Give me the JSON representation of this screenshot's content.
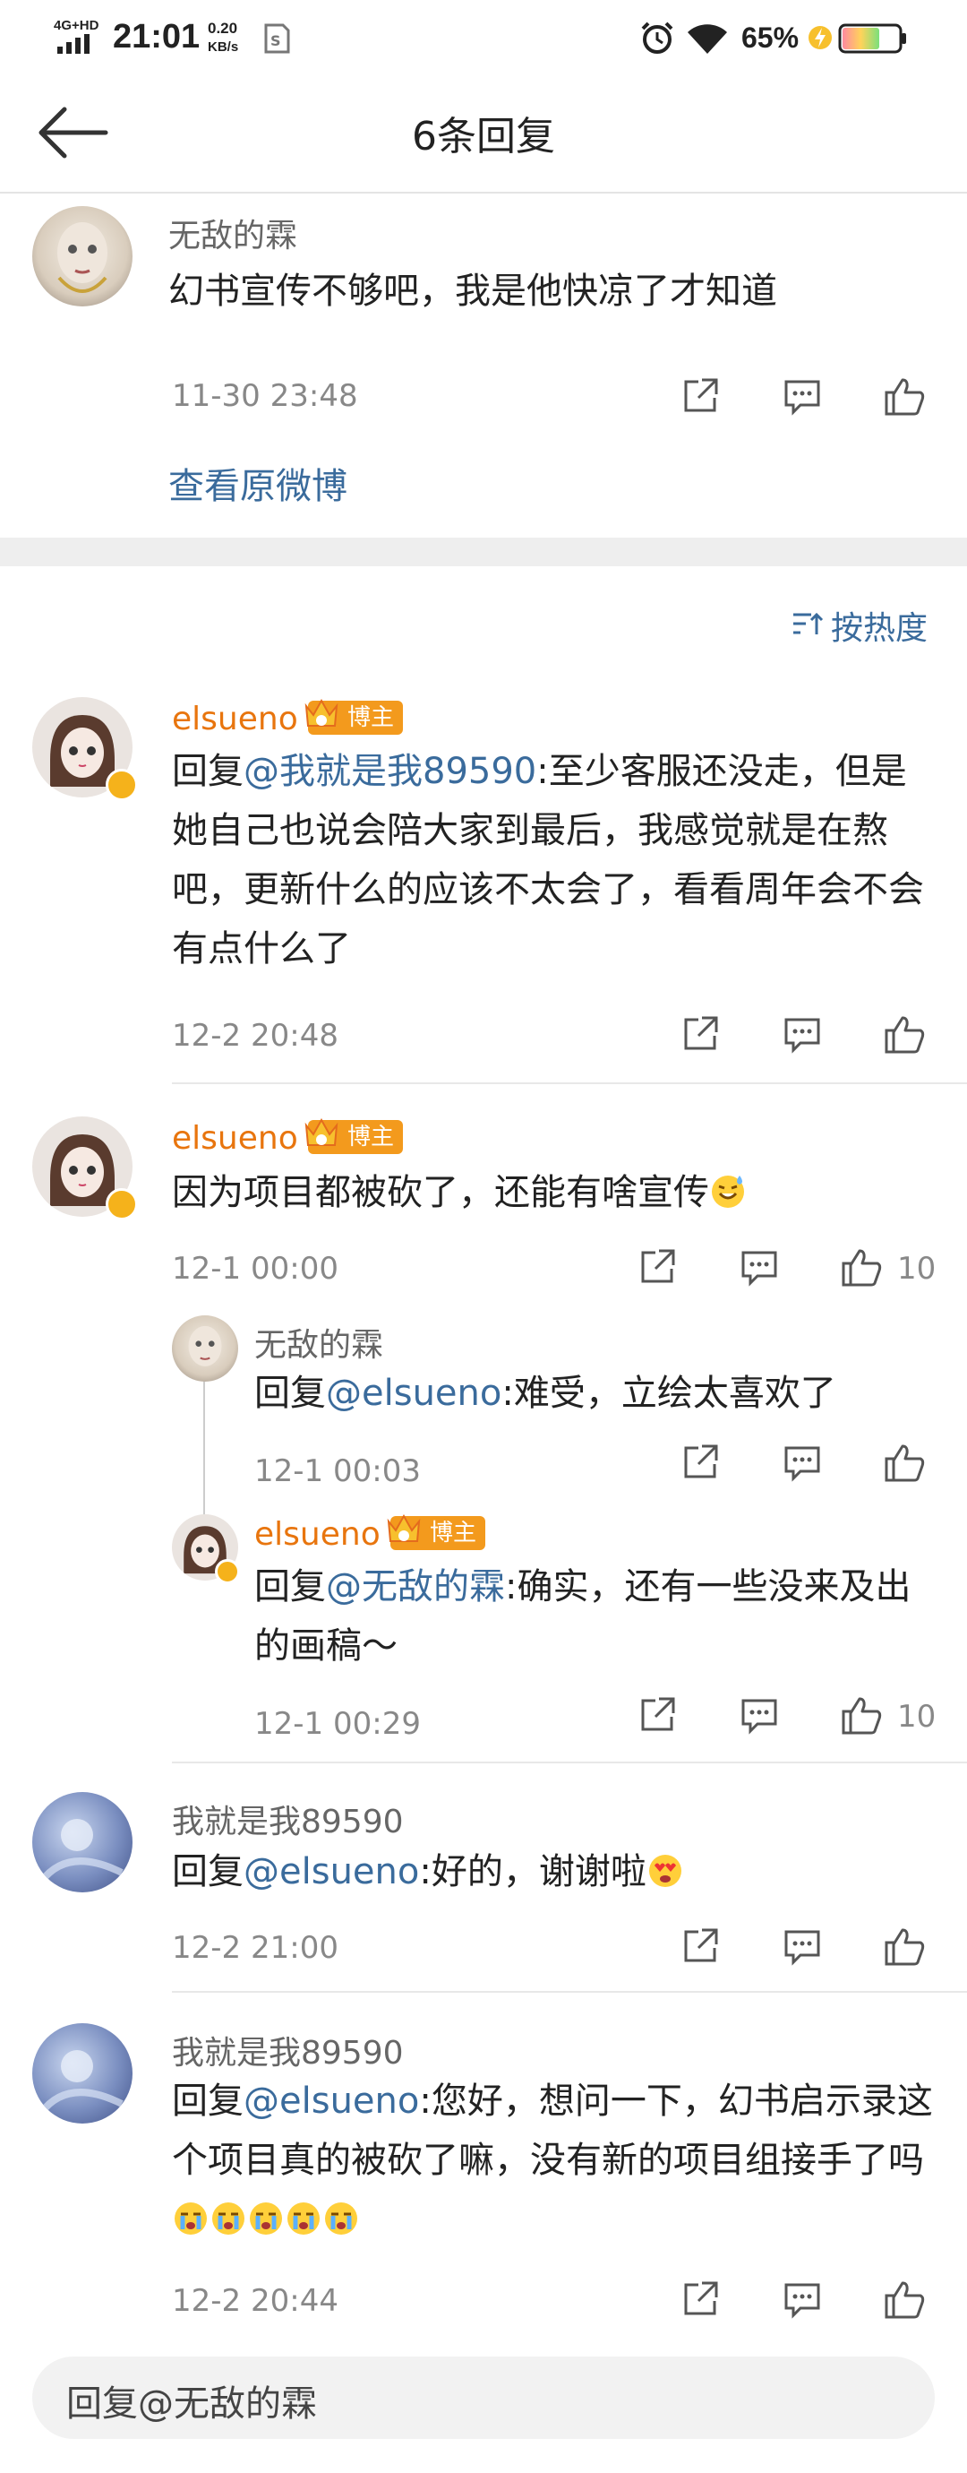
{
  "status": {
    "network": "4G+HD",
    "time": "21:01",
    "speed": "0.20",
    "speed_unit": "KB/s",
    "battery": "65%",
    "battery_level": 0.65
  },
  "header": {
    "title": "6条回复"
  },
  "original": {
    "author": "无敌的霖",
    "text": "幻书宣传不够吧，我是他快凉了才知道",
    "time": "11-30 23:48",
    "view_link": "查看原微博"
  },
  "sort": {
    "label": "按热度"
  },
  "replies": [
    {
      "author": "elsueno",
      "badge": "博主",
      "prefix": "回复",
      "mention": "@我就是我89590",
      "text": ":至少客服还没走，但是她自己也说会陪大家到最后，我感觉就是在熬吧，更新什么的应该不太会了，看看周年会不会有点什么了",
      "time": "12-2 20:48"
    },
    {
      "author": "elsueno",
      "badge": "博主",
      "text": "因为项目都被砍了，还能有啥宣传",
      "time": "12-1 00:00",
      "likes": "10",
      "sub": [
        {
          "author": "无敌的霖",
          "prefix": "回复",
          "mention": "@elsueno",
          "text": ":难受，立绘太喜欢了",
          "time": "12-1 00:03"
        },
        {
          "author": "elsueno",
          "badge": "博主",
          "prefix": "回复",
          "mention": "@无敌的霖",
          "text": ":确实，还有一些没来及出的画稿～",
          "time": "12-1 00:29",
          "likes": "10"
        }
      ]
    },
    {
      "author": "我就是我89590",
      "prefix": "回复",
      "mention": "@elsueno",
      "text": ":好的，谢谢啦",
      "time": "12-2 21:00"
    },
    {
      "author": "我就是我89590",
      "prefix": "回复",
      "mention": "@elsueno",
      "text": ":您好，想问一下，幻书启示录这个项目真的被砍了嘛，没有新的项目组接手了吗",
      "time": "12-2 20:44"
    }
  ],
  "input": {
    "placeholder": "回复@无敌的霖"
  },
  "colors": {
    "accent_blue": "#3a6b9c",
    "author_orange": "#e8750e",
    "badge_orange": "#f39a1d"
  }
}
